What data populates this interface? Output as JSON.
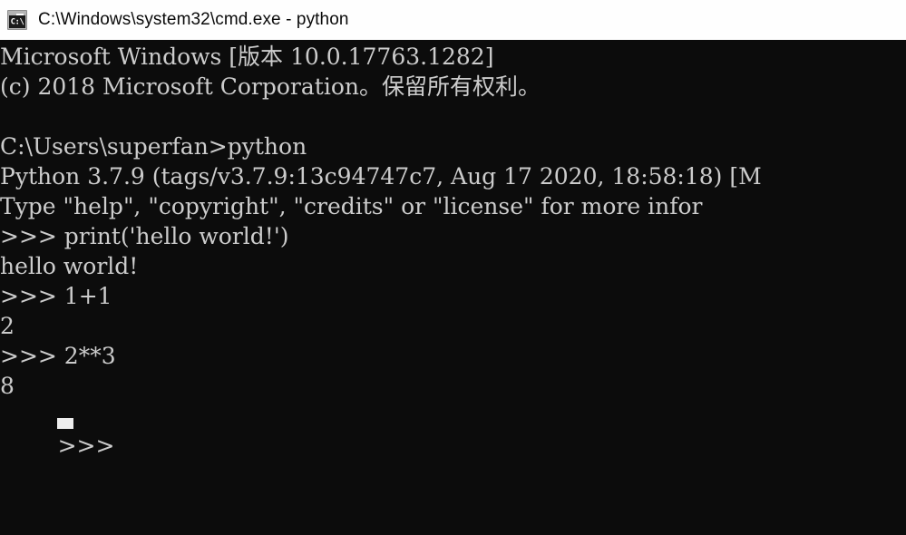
{
  "window": {
    "title": "C:\\Windows\\system32\\cmd.exe - python",
    "icon": "cmd-console-icon",
    "icon_glyph": "C:\\",
    "background_color": "#0c0c0c",
    "foreground_color": "#cccccc",
    "titlebar_background_color": "#fefefe",
    "titlebar_text_color": "#0a0a0a"
  },
  "console": {
    "cursor": {
      "shape": "block",
      "color": "#ededed",
      "column": 4,
      "row": 13
    },
    "lines": [
      {
        "id": "line-1",
        "text": "Microsoft Windows [版本 10.0.17763.1282]"
      },
      {
        "id": "line-2",
        "text": "(c) 2018 Microsoft Corporation。保留所有权利。"
      },
      {
        "id": "line-3",
        "text": ""
      },
      {
        "id": "line-4",
        "text": "C:\\Users\\superfan>python"
      },
      {
        "id": "line-5",
        "text": "Python 3.7.9 (tags/v3.7.9:13c94747c7, Aug 17 2020, 18:58:18) [M"
      },
      {
        "id": "line-6",
        "text": "Type \"help\", \"copyright\", \"credits\" or \"license\" for more infor"
      },
      {
        "id": "line-7",
        "text": ">>> print('hello world!')"
      },
      {
        "id": "line-8",
        "text": "hello world!"
      },
      {
        "id": "line-9",
        "text": ">>> 1+1"
      },
      {
        "id": "line-10",
        "text": "2"
      },
      {
        "id": "line-11",
        "text": ">>> 2**3"
      },
      {
        "id": "line-12",
        "text": "8"
      },
      {
        "id": "line-13",
        "text": ">>> "
      }
    ]
  }
}
